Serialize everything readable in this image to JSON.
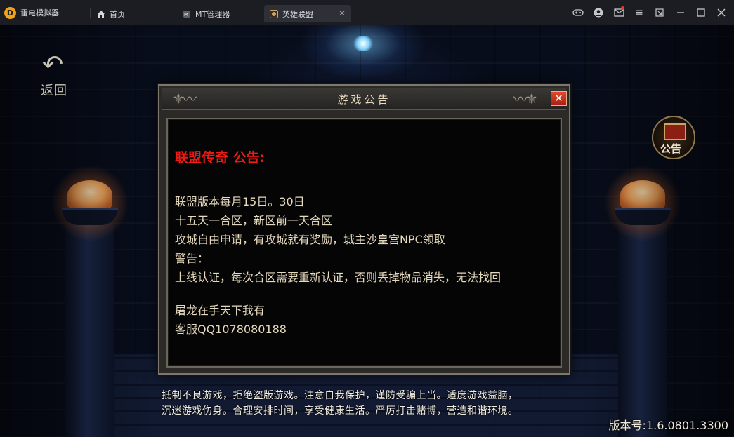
{
  "emulator": {
    "app_name": "雷电模拟器",
    "tabs": [
      {
        "label": "首页",
        "icon": "home-icon"
      },
      {
        "label": "MT管理器",
        "icon": "app-icon"
      },
      {
        "label": "英雄联盟",
        "icon": "game-icon",
        "active": true
      }
    ],
    "window_icons": [
      "gamepad-icon",
      "user-icon",
      "mail-icon",
      "menu-icon",
      "restore-small-icon",
      "minimize-icon",
      "maximize-icon",
      "close-icon"
    ]
  },
  "game": {
    "back_label": "返回",
    "notice_button_label": "公告",
    "dialog": {
      "title": "游戏公告",
      "close_glyph": "✕",
      "heading": "联盟传奇 公告:",
      "lines": [
        "联盟版本每月15日。30日",
        "十五天一合区，新区前一天合区",
        "攻城自由申请，有攻城就有奖励，城主沙皇宫NPC领取",
        "警告：",
        "上线认证，每次合区需要重新认证，否则丢掉物品消失，无法找回",
        "屠龙在手天下我有",
        " 客服QQ1078080188"
      ]
    },
    "footer": {
      "line1": "抵制不良游戏，拒绝盗版游戏。注意自我保护，谨防受骗上当。适度游戏益脑，",
      "line2": "沉迷游戏伤身。合理安排时间，享受健康生活。严厉打击赌博，营造和谐环境。"
    },
    "version": "版本号:1.6.0801.3300"
  },
  "colors": {
    "heading_red": "#ec1b14",
    "body_text": "#e6d9bd",
    "close_red": "#c9301c",
    "brand_orange": "#f2a11a"
  }
}
